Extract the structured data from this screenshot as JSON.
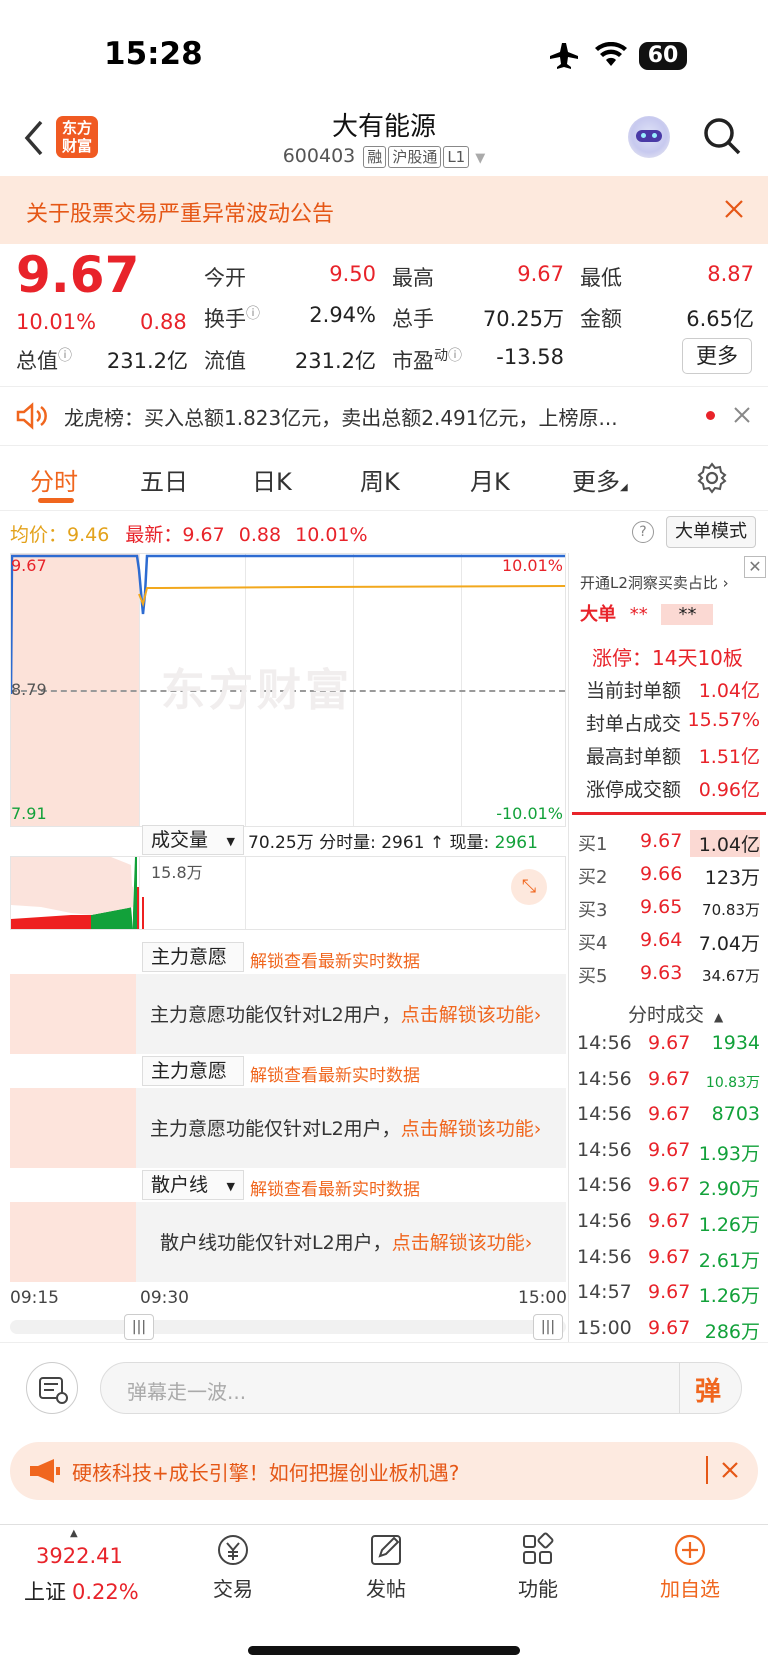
{
  "status_bar": {
    "time": "15:28",
    "battery": "60"
  },
  "header": {
    "logo_line1": "东方",
    "logo_line2": "财富",
    "title": "大有能源",
    "code": "600403",
    "tags": [
      "融",
      "沪股通",
      "L1"
    ]
  },
  "notice": {
    "text": "关于股票交易严重异常波动公告"
  },
  "quote": {
    "price": "9.67",
    "change_pct": "10.01%",
    "change": "0.88",
    "open_label": "今开",
    "open": "9.50",
    "high_label": "最高",
    "high": "9.67",
    "low_label": "最低",
    "low": "8.87",
    "turnover_label": "换手",
    "turnover": "2.94%",
    "volume_label": "总手",
    "volume": "70.25万",
    "amount_label": "金额",
    "amount": "6.65亿",
    "mcap_label": "总值",
    "mcap": "231.2亿",
    "float_label": "流值",
    "float": "231.2亿",
    "pe_label": "市盈",
    "pe_sup": "动",
    "pe": "-13.58",
    "more_button": "更多"
  },
  "dragon_tiger": {
    "text": "龙虎榜：买入总额1.823亿元，卖出总额2.491亿元，上榜原..."
  },
  "tabs": [
    "分时",
    "五日",
    "日K",
    "周K",
    "月K",
    "更多"
  ],
  "info_bar": {
    "avg_label": "均价：",
    "avg": "9.46",
    "latest_label": "最新：",
    "latest": "9.67",
    "change": "0.88",
    "change_pct": "10.01%",
    "mode_button": "大单模式"
  },
  "chart": {
    "left_top": "9.67",
    "left_mid": "8.79",
    "left_bottom": "7.91",
    "right_top": "10.01%",
    "right_bottom": "-10.01%",
    "watermark": "东方财富",
    "volume_dropdown": "成交量",
    "volume_info": "70.25万 分时量: 2961 ↑ 现量: ",
    "volume_now": "2961",
    "volume_axis": "15.8万",
    "time_start": "09:15",
    "time_open": "09:30",
    "time_end": "15:00"
  },
  "chart_data": {
    "type": "line",
    "x": [
      "09:15",
      "09:30",
      "15:00"
    ],
    "series": [
      {
        "name": "均价",
        "values": [
          9.46
        ]
      }
    ],
    "ylim": [
      7.91,
      9.67
    ]
  },
  "locked_panels": [
    {
      "dropdown": "主力意愿",
      "unlock_hint": "解锁查看最新实时数据",
      "message": "主力意愿功能仅针对L2用户，",
      "link": "点击解锁该功能›"
    },
    {
      "dropdown": "主力意愿",
      "unlock_hint": "解锁查看最新实时数据",
      "message": "主力意愿功能仅针对L2用户，",
      "link": "点击解锁该功能›"
    },
    {
      "dropdown": "散户线",
      "unlock_hint": "解锁查看最新实时数据",
      "message": "散户线功能仅针对L2用户，",
      "link": "点击解锁该功能›"
    }
  ],
  "side": {
    "l2_link": "开通L2洞察买卖占比 ›",
    "big_order": "大单",
    "big_mask1": "**",
    "big_mask2": "**",
    "limit_label": "涨停：",
    "limit_value": "14天10板",
    "stats": [
      {
        "label": "当前封单额",
        "value": "1.04亿"
      },
      {
        "label": "封单占成交",
        "value": "15.57%"
      },
      {
        "label": "最高封单额",
        "value": "1.51亿"
      },
      {
        "label": "涨停成交额",
        "value": "0.96亿"
      }
    ],
    "bids": [
      {
        "label": "买1",
        "price": "9.67",
        "vol": "1.04亿"
      },
      {
        "label": "买2",
        "price": "9.66",
        "vol": "123万"
      },
      {
        "label": "买3",
        "price": "9.65",
        "vol": "70.83万"
      },
      {
        "label": "买4",
        "price": "9.64",
        "vol": "7.04万"
      },
      {
        "label": "买5",
        "price": "9.63",
        "vol": "34.67万"
      }
    ],
    "ticks_title": "分时成交",
    "ticks": [
      {
        "time": "14:56",
        "price": "9.67",
        "vol": "1934"
      },
      {
        "time": "14:56",
        "price": "9.67",
        "vol": "10.83万"
      },
      {
        "time": "14:56",
        "price": "9.67",
        "vol": "8703"
      },
      {
        "time": "14:56",
        "price": "9.67",
        "vol": "1.93万"
      },
      {
        "time": "14:56",
        "price": "9.67",
        "vol": "2.90万"
      },
      {
        "time": "14:56",
        "price": "9.67",
        "vol": "1.26万"
      },
      {
        "time": "14:56",
        "price": "9.67",
        "vol": "2.61万"
      },
      {
        "time": "14:57",
        "price": "9.67",
        "vol": "1.26万"
      },
      {
        "time": "15:00",
        "price": "9.67",
        "vol": "286万"
      }
    ]
  },
  "danmaku": {
    "placeholder": "弹幕走一波...",
    "send": "弹"
  },
  "ad": {
    "text": "硬核科技+成长引擎！如何把握创业板机遇?"
  },
  "bottom_bar": {
    "index_value": "3922.41",
    "index_name": "上证",
    "index_change": "0.22%",
    "items": [
      "交易",
      "发帖",
      "功能",
      "加自选"
    ]
  }
}
